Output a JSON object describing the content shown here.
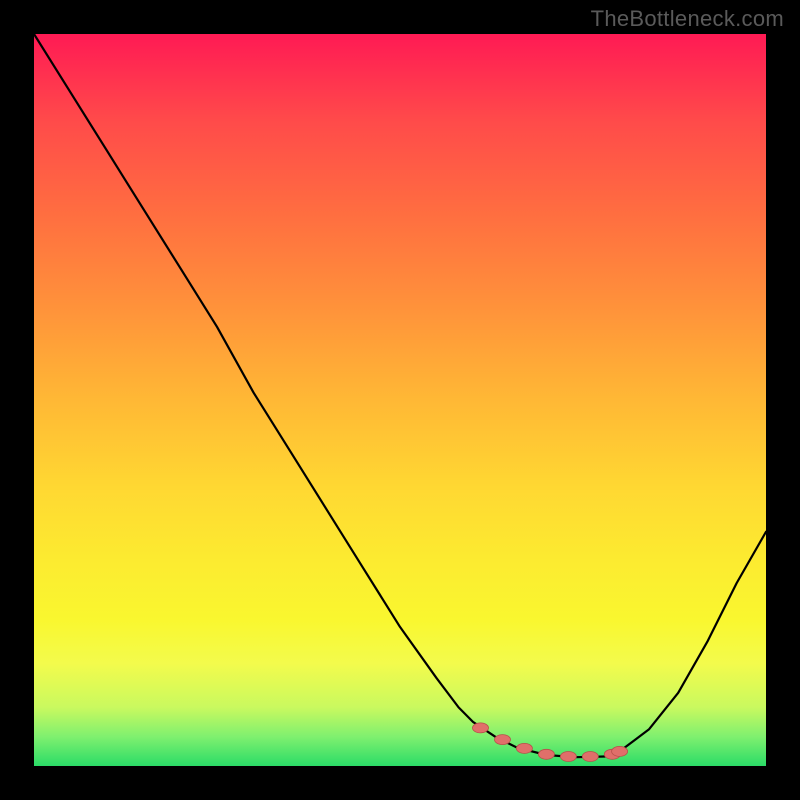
{
  "watermark": "TheBottleneck.com",
  "colors": {
    "page_bg": "#000000",
    "gradient_top": "#ff1a54",
    "gradient_bottom": "#2bdc67",
    "curve": "#000000",
    "marker_fill": "#e06f6a",
    "marker_stroke": "#b84f4a"
  },
  "chart_data": {
    "type": "line",
    "title": "",
    "xlabel": "",
    "ylabel": "",
    "xlim": [
      0,
      100
    ],
    "ylim": [
      0,
      100
    ],
    "grid": false,
    "legend": false,
    "series": [
      {
        "name": "bottleneck-curve",
        "x": [
          0,
          5,
          10,
          15,
          20,
          25,
          30,
          35,
          40,
          45,
          50,
          55,
          58,
          60,
          63,
          66,
          70,
          74,
          78,
          80,
          84,
          88,
          92,
          96,
          100
        ],
        "values": [
          100,
          92,
          84,
          76,
          68,
          60,
          51,
          43,
          35,
          27,
          19,
          12,
          8,
          6,
          4,
          2.5,
          1.5,
          1.2,
          1.3,
          2,
          5,
          10,
          17,
          25,
          32
        ]
      }
    ],
    "markers": {
      "name": "highlight-dots",
      "x": [
        61,
        64,
        67,
        70,
        73,
        76,
        79,
        80
      ],
      "values": [
        5.2,
        3.6,
        2.4,
        1.6,
        1.3,
        1.3,
        1.6,
        2.0
      ]
    }
  }
}
